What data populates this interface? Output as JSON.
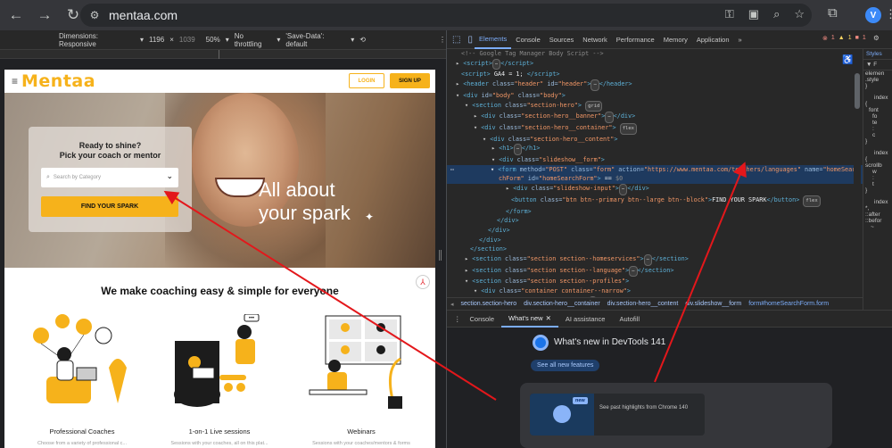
{
  "browser": {
    "url": "mentaa.com",
    "profile_initial": "V"
  },
  "device_toolbar": {
    "dimensions_label": "Dimensions: Responsive",
    "width": "1196",
    "times": "×",
    "height": "1039",
    "zoom": "50%",
    "throttling": "No throttling",
    "save_data": "'Save-Data': default"
  },
  "site": {
    "logo": "Mentaa",
    "login_label": "LOGIN",
    "signup_label": "SIGN UP",
    "hero_title_line1": "All about",
    "hero_title_line2": "your spark",
    "card_title_line1": "Ready to shine?",
    "card_title_line2": "Pick your coach or mentor",
    "search_placeholder": "Search by Category",
    "find_button": "FIND YOUR SPARK",
    "section_title": "We make coaching easy & simple for everyone",
    "services": [
      {
        "label": "Professional Coaches",
        "sub": "Choose from a variety of professional c..."
      },
      {
        "label": "1-on-1 Live sessions",
        "sub": "Sessions with your coaches, all on this plat..."
      },
      {
        "label": "Webinars",
        "sub": "Sessions with your coaches/mentors & forms"
      }
    ]
  },
  "devtools": {
    "tabs": [
      "Elements",
      "Console",
      "Sources",
      "Network",
      "Performance",
      "Memory",
      "Application"
    ],
    "more": "»",
    "error_count": "1",
    "warn_count": "1",
    "issue_count": "1",
    "styles_tab": "Styles",
    "styles_lines": [
      "elemen",
      ".style",
      "}",
      "index",
      "{",
      "font",
      "fo",
      "te",
      ":",
      "c",
      "}",
      "index",
      "{",
      "scrollb",
      "w",
      ":",
      "t",
      "}",
      "index",
      "*,",
      "::after",
      "::befor",
      "~"
    ],
    "breadcrumb": [
      "section.section-hero",
      "div.section-hero__container",
      "div.section-hero__content",
      "div.slideshow__form",
      "form#homeSearchForm.form"
    ],
    "drawer_tabs": [
      "Console",
      "What's new",
      "AI assistance",
      "Autofill"
    ],
    "whats_new_title": "What's new in DevTools 141",
    "see_all": "See all new features",
    "new_badge": "new",
    "highlight_text": "See past highlights from Chrome 140"
  }
}
